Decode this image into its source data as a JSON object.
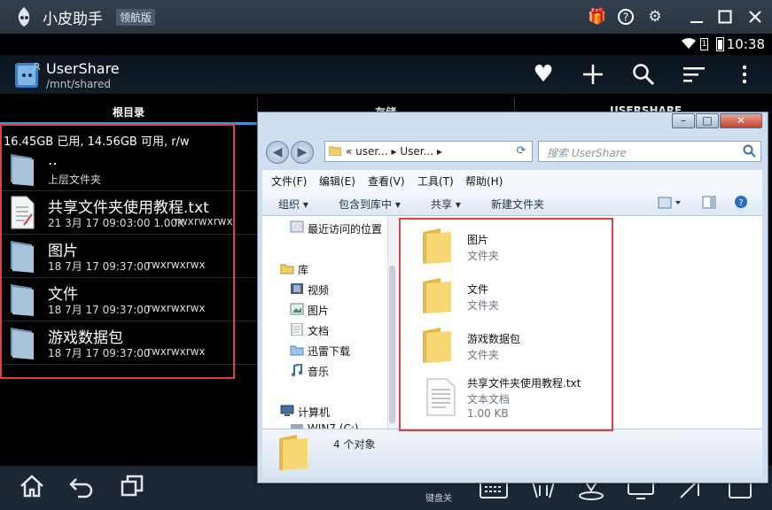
{
  "emulator": {
    "title": "小皮助手",
    "edition": "领航版",
    "toolbar_icons": [
      "gift-icon",
      "help-icon",
      "settings-icon",
      "minimize-icon",
      "maximize-icon",
      "close-icon"
    ]
  },
  "status_bar": {
    "time": "10:38",
    "sim_label": "1"
  },
  "app": {
    "title": "UserShare",
    "path": "/mnt/shared",
    "icon_badge": "R",
    "actions": [
      "favorite-icon",
      "add-icon",
      "search-icon",
      "sort-icon",
      "overflow-menu-icon"
    ]
  },
  "tabs": [
    {
      "label": "根目录",
      "active": true
    },
    {
      "label": "存储",
      "active": false
    },
    {
      "label": "USERSHARE",
      "active": false
    }
  ],
  "storage_summary": "16.45GB 已用, 14.56GB 可用, r/w",
  "files": [
    {
      "name": "..",
      "meta": "上层文件夹",
      "perm": "",
      "icon": "folder-icon"
    },
    {
      "name": "共享文件夹使用教程.txt",
      "meta": "21 3月 17 09:03:00  1.00K",
      "perm": "rwxrwxrwx",
      "icon": "text-file-icon"
    },
    {
      "name": "图片",
      "meta": "18 7月 17 09:37:00",
      "perm": "rwxrwxrwx",
      "icon": "folder-icon"
    },
    {
      "name": "文件",
      "meta": "18 7月 17 09:37:00",
      "perm": "rwxrwxrwx",
      "icon": "folder-icon"
    },
    {
      "name": "游戏数据包",
      "meta": "18 7月 17 09:37:00",
      "perm": "rwxrwxrwx",
      "icon": "folder-icon"
    }
  ],
  "navbar": {
    "keyboard_caption": "键盘关",
    "buttons": [
      "home-icon",
      "back-icon",
      "recent-apps-icon",
      "keyboard-icon",
      "shake-icon",
      "location-icon",
      "screen-icon",
      "rotate-icon"
    ]
  },
  "explorer": {
    "address": "«  user...  ▸  User...  ▸",
    "search_placeholder": "搜索 UserShare",
    "menu": [
      "文件(F)",
      "编辑(E)",
      "查看(V)",
      "工具(T)",
      "帮助(H)"
    ],
    "commands": [
      "组织 ▾",
      "包含到库中 ▾",
      "共享 ▾",
      "新建文件夹"
    ],
    "nav_items": [
      {
        "label": "最近访问的位置"
      },
      {
        "label": "库"
      },
      {
        "label": "视频"
      },
      {
        "label": "图片"
      },
      {
        "label": "文档"
      },
      {
        "label": "迅雷下载"
      },
      {
        "label": "音乐"
      },
      {
        "label": "计算机"
      },
      {
        "label": "WIN7 (C:)"
      }
    ],
    "items": [
      {
        "name": "图片",
        "type": "文件夹",
        "size": ""
      },
      {
        "name": "文件",
        "type": "文件夹",
        "size": ""
      },
      {
        "name": "游戏数据包",
        "type": "文件夹",
        "size": ""
      },
      {
        "name": "共享文件夹使用教程.txt",
        "type": "文本文档",
        "size": "1.00 KB"
      }
    ],
    "details": "4 个对象"
  },
  "colors": {
    "highlight_box": "#e04040",
    "tab_underline": "#3a9ad9",
    "folder": "#f2cf64"
  }
}
